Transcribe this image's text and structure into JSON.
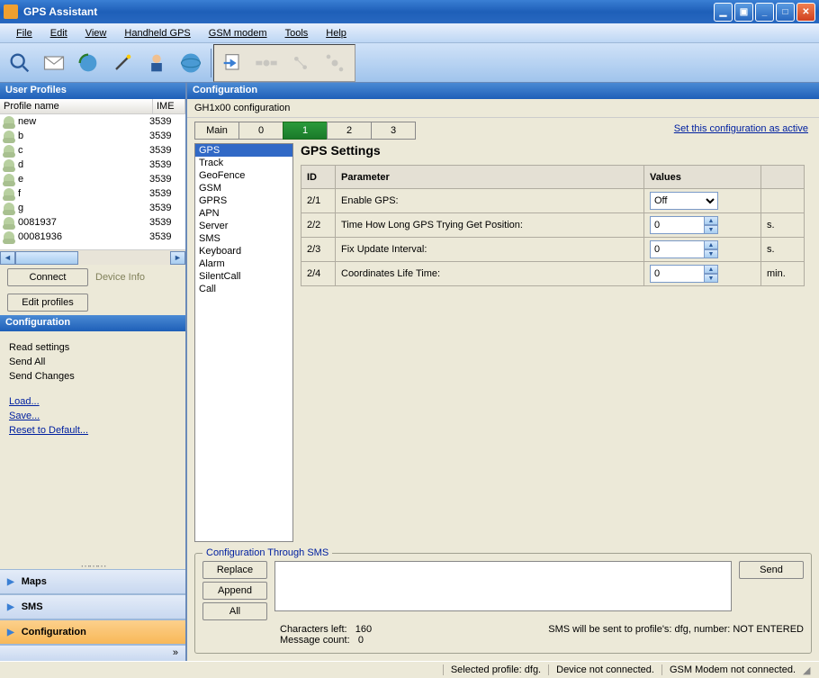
{
  "app": {
    "title": "GPS Assistant"
  },
  "menu": [
    "File",
    "Edit",
    "View",
    "Handheld GPS",
    "GSM modem",
    "Tools",
    "Help"
  ],
  "left": {
    "profiles_title": "User Profiles",
    "col_name": "Profile name",
    "col_ime": "IME",
    "profiles": [
      {
        "name": "new",
        "ime": "3539"
      },
      {
        "name": "b",
        "ime": "3539"
      },
      {
        "name": "c",
        "ime": "3539"
      },
      {
        "name": "d",
        "ime": "3539"
      },
      {
        "name": "e",
        "ime": "3539"
      },
      {
        "name": "f",
        "ime": "3539"
      },
      {
        "name": "g",
        "ime": "3539"
      },
      {
        "name": "0081937",
        "ime": "3539"
      },
      {
        "name": "00081936",
        "ime": "3539"
      }
    ],
    "btn_connect": "Connect",
    "lbl_device_info": "Device Info",
    "btn_edit_profiles": "Edit profiles",
    "config_title": "Configuration",
    "actions": {
      "read": "Read settings",
      "sendall": "Send All",
      "sendch": "Send Changes",
      "load": "Load...",
      "save": "Save...",
      "reset": "Reset to Default..."
    },
    "nav": {
      "maps": "Maps",
      "sms": "SMS",
      "config": "Configuration",
      "expand": "»"
    }
  },
  "config": {
    "title": "Configuration",
    "name": "GH1x00 configuration",
    "tabs": [
      "Main",
      "0",
      "1",
      "2",
      "3"
    ],
    "active_tab": 2,
    "set_active": "Set this configuration as active",
    "categories": [
      "GPS",
      "Track",
      "GeoFence",
      "GSM",
      "GPRS",
      "APN",
      "Server",
      "SMS",
      "Keyboard",
      "Alarm",
      "SilentCall",
      "Call"
    ],
    "selected_cat": 0,
    "section_title": "GPS Settings",
    "headers": {
      "id": "ID",
      "param": "Parameter",
      "values": "Values"
    },
    "rows": [
      {
        "id": "2/1",
        "param": "Enable GPS:",
        "value": "Off",
        "type": "select",
        "unit": ""
      },
      {
        "id": "2/2",
        "param": "Time How Long GPS Trying Get Position:",
        "value": "0",
        "type": "spin",
        "unit": "s."
      },
      {
        "id": "2/3",
        "param": "Fix Update Interval:",
        "value": "0",
        "type": "spin",
        "unit": "s."
      },
      {
        "id": "2/4",
        "param": "Coordinates Life Time:",
        "value": "0",
        "type": "spin",
        "unit": "min."
      }
    ]
  },
  "sms": {
    "legend": "Configuration Through SMS",
    "btn_replace": "Replace",
    "btn_append": "Append",
    "btn_all": "All",
    "btn_send": "Send",
    "chars_label": "Characters left:",
    "chars": "160",
    "msg_label": "Message count:",
    "msg": "0",
    "dest": "SMS will be sent to profile's: dfg, number: NOT ENTERED"
  },
  "status": {
    "profile": "Selected profile: dfg.",
    "device": "Device not connected.",
    "modem": "GSM Modem not connected."
  }
}
